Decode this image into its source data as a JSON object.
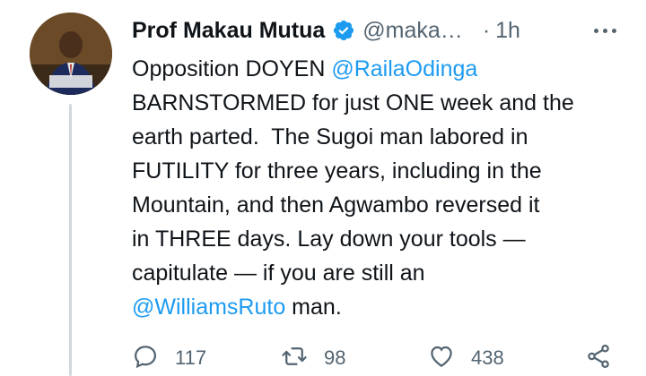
{
  "author": {
    "name": "Prof Makau Mutua",
    "handle": "@maka…",
    "time": "1h",
    "separator": "·",
    "verified": true
  },
  "tweet": {
    "segments": [
      {
        "text": "Opposition DOYEN ",
        "type": "text"
      },
      {
        "text": "@RailaOdinga",
        "type": "mention"
      },
      {
        "text": "\nBARNSTORMED for just ONE week and the\nearth parted.  The Sugoi man labored in\nFUTILITY for three years, including in the\nMountain, and then Agwambo reversed it\nin THREE days. Lay down your tools —\ncapitulate — if you are still an\n",
        "type": "text"
      },
      {
        "text": "@WilliamsRuto",
        "type": "mention"
      },
      {
        "text": " man.",
        "type": "text"
      }
    ]
  },
  "actions": {
    "reply": {
      "icon": "reply-icon",
      "count": "117"
    },
    "retweet": {
      "icon": "retweet-icon",
      "count": "98"
    },
    "like": {
      "icon": "heart-icon",
      "count": "438"
    },
    "share": {
      "icon": "share-icon"
    }
  },
  "colors": {
    "link": "#1d9bf0",
    "secondary": "#536471",
    "text": "#0f1419",
    "verified": "#1d9bf0"
  }
}
